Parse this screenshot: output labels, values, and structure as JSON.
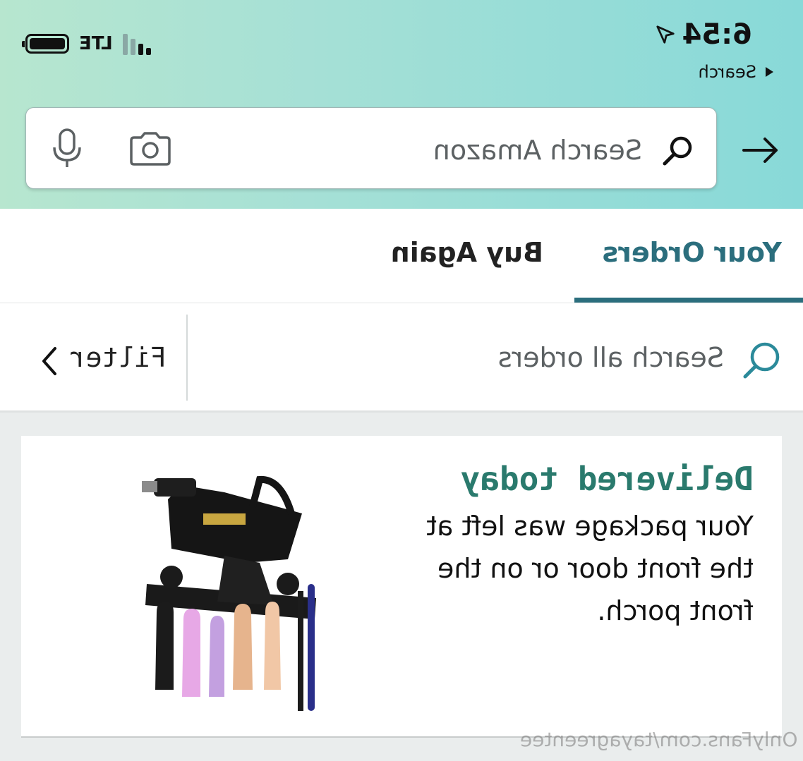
{
  "status_bar": {
    "time": "6:54",
    "back_label": "Search",
    "network": "LTE"
  },
  "search": {
    "placeholder": "Search Amazon"
  },
  "tabs": [
    {
      "label": "Your Orders",
      "active": true
    },
    {
      "label": "Buy Again",
      "active": false
    }
  ],
  "order_search": {
    "placeholder": "Search all orders",
    "filter_label": "Filter"
  },
  "order": {
    "status": "Delivered today",
    "message": "Your package was left at the front door or on the front porch."
  },
  "watermark": "OnlyFans.com/tayagreentee",
  "colors": {
    "accent": "#2b6e7d",
    "delivered": "#2a7a6d",
    "header_start": "#88d9d8",
    "header_end": "#b7e6cf"
  },
  "icons": [
    "search-icon",
    "camera-icon",
    "microphone-icon",
    "back-arrow-icon",
    "chevron-right-icon",
    "location-arrow-icon",
    "battery-icon",
    "signal-icon"
  ]
}
